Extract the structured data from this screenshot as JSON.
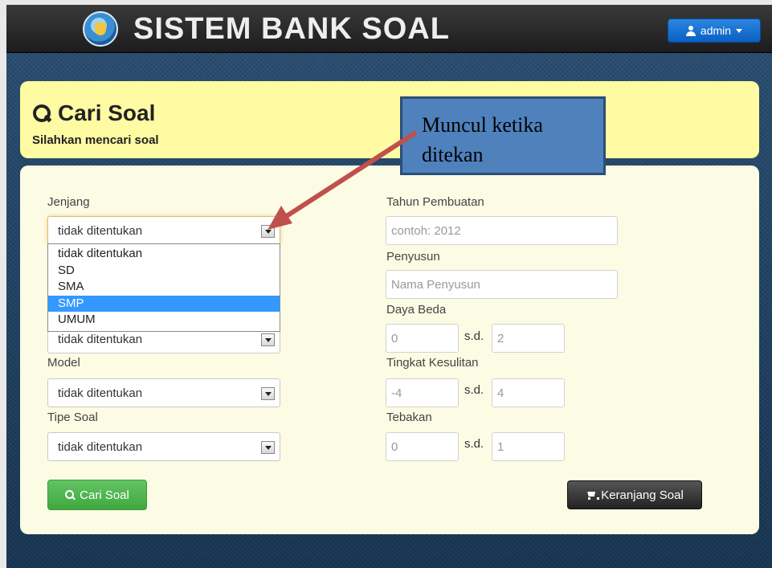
{
  "app": {
    "title": "SISTEM BANK SOAL",
    "user_menu_label": "admin"
  },
  "header": {
    "title": "Cari Soal",
    "subtitle": "Silahkan mencari soal"
  },
  "form": {
    "jenjang": {
      "label": "Jenjang",
      "value": "tidak ditentukan",
      "options": [
        "tidak ditentukan",
        "SD",
        "SMA",
        "SMP",
        "UMUM"
      ],
      "highlighted": "SMP"
    },
    "hidden_select_value": "tidak ditentukan",
    "model": {
      "label": "Model",
      "value": "tidak ditentukan"
    },
    "tipe_soal": {
      "label": "Tipe Soal",
      "value": "tidak ditentukan"
    },
    "tahun_pembuatan": {
      "label": "Tahun Pembuatan",
      "placeholder": "contoh: 2012"
    },
    "penyusun": {
      "label": "Penyusun",
      "placeholder": "Nama Penyusun"
    },
    "range_separator": "s.d.",
    "daya_beda": {
      "label": "Daya Beda",
      "from": "0",
      "to": "2"
    },
    "tingkat_kesulitan": {
      "label": "Tingkat Kesulitan",
      "from": "-4",
      "to": "4"
    },
    "tebakan": {
      "label": "Tebakan",
      "from": "0",
      "to": "1"
    }
  },
  "buttons": {
    "cari": "Cari Soal",
    "keranjang": "Keranjang Soal"
  },
  "annotation": {
    "text": "Muncul ketika ditekan"
  },
  "colors": {
    "topbar": "#1c1c1c",
    "header_card": "#fefba3",
    "form_card": "#fcfbe4",
    "admin_button": "#0a5fc4",
    "search_button": "#40a840",
    "cart_button": "#222222",
    "option_highlight": "#3399ff",
    "callout": "#4f81bd",
    "arrow": "#c0504d"
  }
}
